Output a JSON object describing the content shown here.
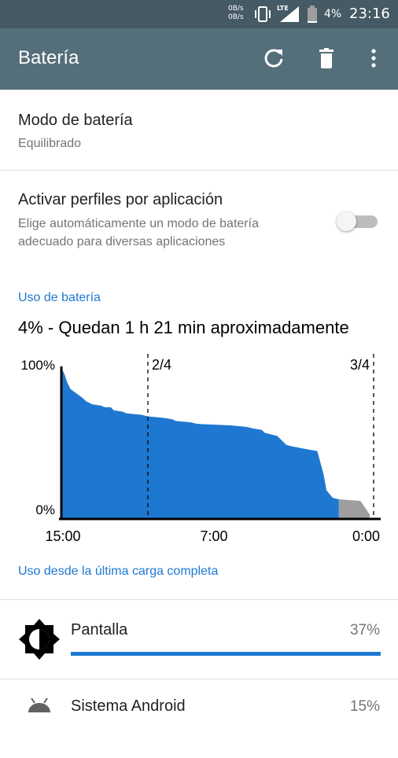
{
  "status_bar": {
    "upload_speed": "0B/s",
    "download_speed": "0B/s",
    "network_type": "LTE",
    "battery_percent": "4%",
    "time": "23:16",
    "icons": [
      "vibrate-icon",
      "signal-icon",
      "battery-icon"
    ]
  },
  "app_bar": {
    "title": "Batería",
    "actions": [
      "refresh-icon",
      "delete-icon",
      "more-options-icon"
    ]
  },
  "battery_mode": {
    "title": "Modo de batería",
    "value": "Equilibrado"
  },
  "per_app_profiles": {
    "title": "Activar perfiles por aplicación",
    "summary_line1": "Elige automáticamente un modo de batería",
    "summary_line2": "adecuado para diversas aplicaciones",
    "enabled": false
  },
  "usage_section": {
    "header": "Uso de batería",
    "remaining": "4% - Quedan 1 h 21 min aproximadamente"
  },
  "chart_data": {
    "type": "area",
    "y_labels": [
      "100%",
      "0%"
    ],
    "x_labels": [
      "15:00",
      "7:00",
      "0:00"
    ],
    "markers": [
      "2/4",
      "3/4"
    ],
    "ylim": [
      0,
      100
    ],
    "color": "#1e78d2",
    "projection_color": "#9e9e9e",
    "x": [
      0,
      0.01,
      0.02,
      0.03,
      0.05,
      0.07,
      0.08,
      0.1,
      0.13,
      0.14,
      0.16,
      0.17,
      0.2,
      0.21,
      0.26,
      0.28,
      0.33,
      0.36,
      0.37,
      0.42,
      0.44,
      0.55,
      0.6,
      0.62,
      0.65,
      0.66,
      0.7,
      0.73,
      0.75,
      0.8,
      0.83,
      0.85,
      0.86,
      0.88,
      0.9
    ],
    "y": [
      100,
      96,
      90,
      86,
      83,
      80,
      78,
      76,
      75,
      74,
      74,
      72,
      71,
      70,
      69,
      68,
      67,
      66,
      65,
      64,
      63,
      62,
      61,
      60,
      59,
      57,
      55,
      49,
      48,
      46,
      45,
      30,
      19,
      14,
      13
    ],
    "projection_x": [
      0.9,
      0.97,
      0.99,
      1.0
    ],
    "projection_y": [
      13,
      12,
      6,
      3
    ]
  },
  "usage_since_charge": {
    "header": "Uso desde la última carga completa",
    "items": [
      {
        "label": "Pantalla",
        "percent": "37%",
        "fraction": 0.37,
        "icon": "brightness-icon"
      },
      {
        "label": "Sistema Android",
        "percent": "15%",
        "fraction": 0.15,
        "icon": "android-icon"
      }
    ]
  }
}
